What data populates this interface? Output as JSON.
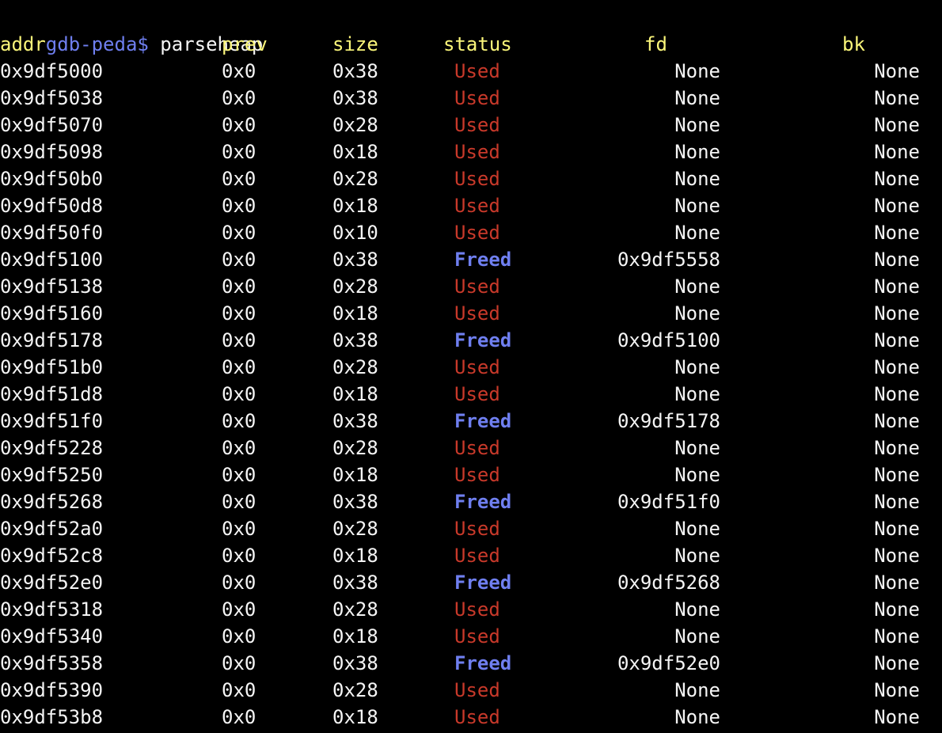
{
  "terminal": {
    "prompt": "gdb-peda$",
    "command": "parseheap",
    "colors": {
      "background": "#000000",
      "text": "#f5f5f5",
      "prompt": "#6f7ff0",
      "header": "#fbf67a",
      "used": "#c8392a",
      "freed": "#6f7ff0"
    }
  },
  "table": {
    "headers": {
      "addr": "addr",
      "prev": "prev",
      "size": "size",
      "status": "status",
      "fd": "fd",
      "bk": "bk"
    },
    "rows": [
      {
        "addr": "0x9df5000",
        "prev": "0x0",
        "size": "0x38",
        "status": "Used",
        "fd": "None",
        "bk": "None"
      },
      {
        "addr": "0x9df5038",
        "prev": "0x0",
        "size": "0x38",
        "status": "Used",
        "fd": "None",
        "bk": "None"
      },
      {
        "addr": "0x9df5070",
        "prev": "0x0",
        "size": "0x28",
        "status": "Used",
        "fd": "None",
        "bk": "None"
      },
      {
        "addr": "0x9df5098",
        "prev": "0x0",
        "size": "0x18",
        "status": "Used",
        "fd": "None",
        "bk": "None"
      },
      {
        "addr": "0x9df50b0",
        "prev": "0x0",
        "size": "0x28",
        "status": "Used",
        "fd": "None",
        "bk": "None"
      },
      {
        "addr": "0x9df50d8",
        "prev": "0x0",
        "size": "0x18",
        "status": "Used",
        "fd": "None",
        "bk": "None"
      },
      {
        "addr": "0x9df50f0",
        "prev": "0x0",
        "size": "0x10",
        "status": "Used",
        "fd": "None",
        "bk": "None"
      },
      {
        "addr": "0x9df5100",
        "prev": "0x0",
        "size": "0x38",
        "status": "Freed",
        "fd": "0x9df5558",
        "bk": "None"
      },
      {
        "addr": "0x9df5138",
        "prev": "0x0",
        "size": "0x28",
        "status": "Used",
        "fd": "None",
        "bk": "None"
      },
      {
        "addr": "0x9df5160",
        "prev": "0x0",
        "size": "0x18",
        "status": "Used",
        "fd": "None",
        "bk": "None"
      },
      {
        "addr": "0x9df5178",
        "prev": "0x0",
        "size": "0x38",
        "status": "Freed",
        "fd": "0x9df5100",
        "bk": "None"
      },
      {
        "addr": "0x9df51b0",
        "prev": "0x0",
        "size": "0x28",
        "status": "Used",
        "fd": "None",
        "bk": "None"
      },
      {
        "addr": "0x9df51d8",
        "prev": "0x0",
        "size": "0x18",
        "status": "Used",
        "fd": "None",
        "bk": "None"
      },
      {
        "addr": "0x9df51f0",
        "prev": "0x0",
        "size": "0x38",
        "status": "Freed",
        "fd": "0x9df5178",
        "bk": "None"
      },
      {
        "addr": "0x9df5228",
        "prev": "0x0",
        "size": "0x28",
        "status": "Used",
        "fd": "None",
        "bk": "None"
      },
      {
        "addr": "0x9df5250",
        "prev": "0x0",
        "size": "0x18",
        "status": "Used",
        "fd": "None",
        "bk": "None"
      },
      {
        "addr": "0x9df5268",
        "prev": "0x0",
        "size": "0x38",
        "status": "Freed",
        "fd": "0x9df51f0",
        "bk": "None"
      },
      {
        "addr": "0x9df52a0",
        "prev": "0x0",
        "size": "0x28",
        "status": "Used",
        "fd": "None",
        "bk": "None"
      },
      {
        "addr": "0x9df52c8",
        "prev": "0x0",
        "size": "0x18",
        "status": "Used",
        "fd": "None",
        "bk": "None"
      },
      {
        "addr": "0x9df52e0",
        "prev": "0x0",
        "size": "0x38",
        "status": "Freed",
        "fd": "0x9df5268",
        "bk": "None"
      },
      {
        "addr": "0x9df5318",
        "prev": "0x0",
        "size": "0x28",
        "status": "Used",
        "fd": "None",
        "bk": "None"
      },
      {
        "addr": "0x9df5340",
        "prev": "0x0",
        "size": "0x18",
        "status": "Used",
        "fd": "None",
        "bk": "None"
      },
      {
        "addr": "0x9df5358",
        "prev": "0x0",
        "size": "0x38",
        "status": "Freed",
        "fd": "0x9df52e0",
        "bk": "None"
      },
      {
        "addr": "0x9df5390",
        "prev": "0x0",
        "size": "0x28",
        "status": "Used",
        "fd": "None",
        "bk": "None"
      },
      {
        "addr": "0x9df53b8",
        "prev": "0x0",
        "size": "0x18",
        "status": "Used",
        "fd": "None",
        "bk": "None"
      }
    ]
  }
}
